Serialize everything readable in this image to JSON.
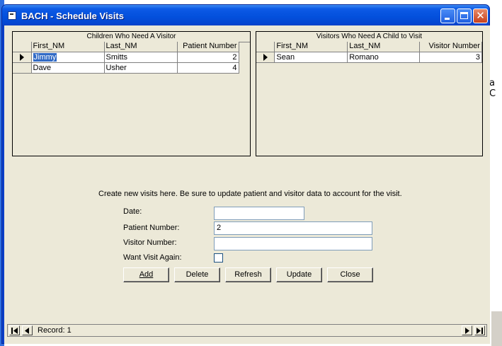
{
  "window": {
    "title": "BACH - Schedule Visits",
    "background_partial_text": "a C"
  },
  "children_grid": {
    "caption": "Children Who Need A Visitor",
    "columns": [
      "First_NM",
      "Last_NM",
      "Patient Number"
    ],
    "rows": [
      {
        "first": "Jimmy",
        "last": "Smitts",
        "number": "2"
      },
      {
        "first": "Dave",
        "last": "Usher",
        "number": "4"
      }
    ]
  },
  "visitors_grid": {
    "caption": "Visitors Who Need A Child to Visit",
    "columns": [
      "First_NM",
      "Last_NM",
      "Visitor Number"
    ],
    "rows": [
      {
        "first": "Sean",
        "last": "Romano",
        "number": "3"
      }
    ]
  },
  "form": {
    "instructions": "Create new visits here.  Be sure to update patient and visitor data to account for the visit.",
    "date_label": "Date:",
    "date_value": "",
    "patient_label": "Patient Number:",
    "patient_value": "2",
    "visitor_label": "Visitor Number:",
    "visitor_value": "",
    "want_again_label": "Want Visit Again:",
    "want_again_checked": false
  },
  "buttons": {
    "add": "Add",
    "delete": "Delete",
    "refresh": "Refresh",
    "update": "Update",
    "close": "Close"
  },
  "navigator": {
    "record_label": "Record: 1"
  },
  "colors": {
    "titlebar": "#0350dc",
    "selection": "#316ac5",
    "client": "#ece9d8"
  }
}
